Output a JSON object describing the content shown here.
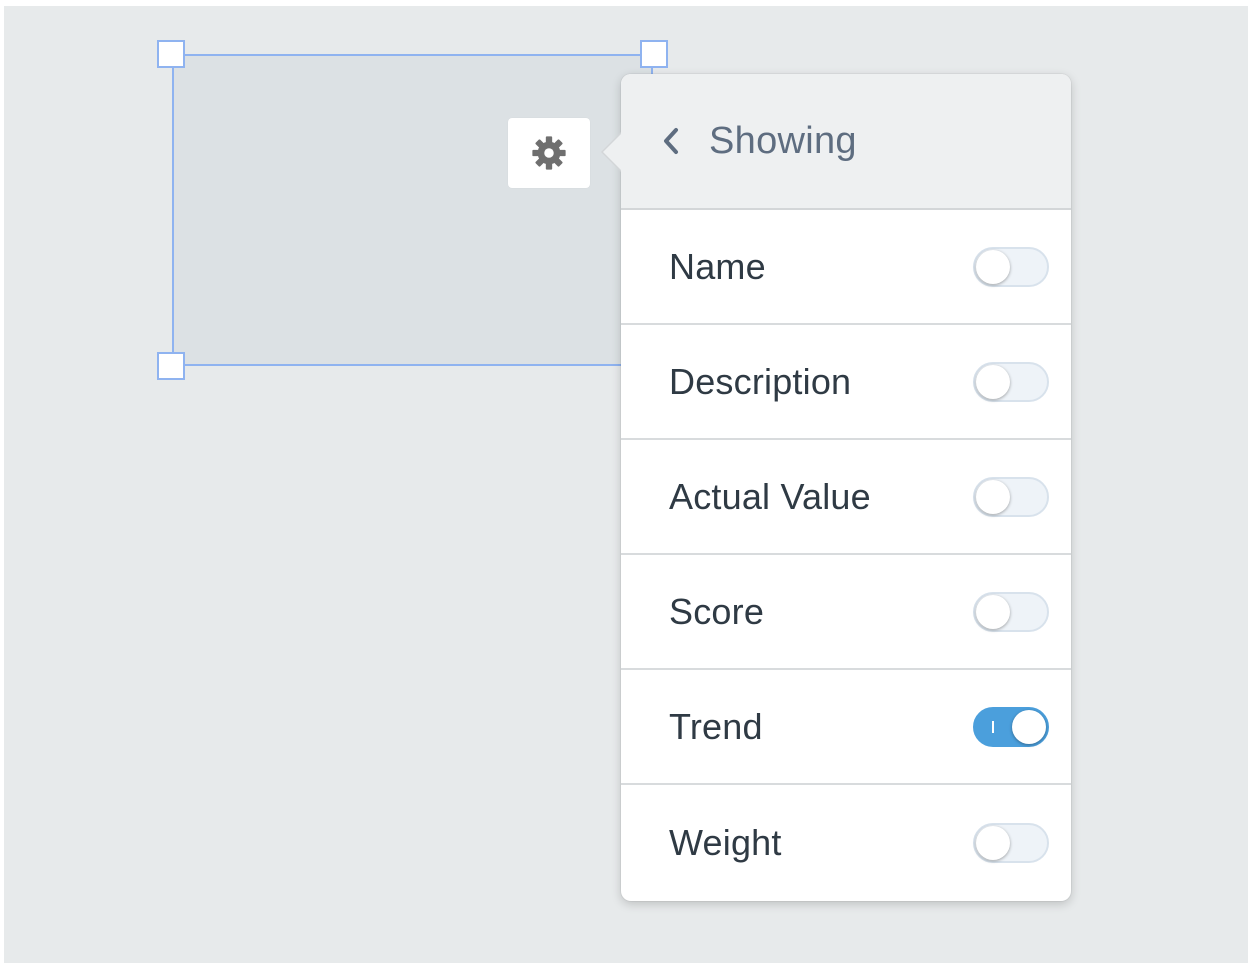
{
  "panel": {
    "title": "Showing",
    "options": [
      {
        "label": "Name",
        "enabled": false
      },
      {
        "label": "Description",
        "enabled": false
      },
      {
        "label": "Actual Value",
        "enabled": false
      },
      {
        "label": "Score",
        "enabled": false
      },
      {
        "label": "Trend",
        "enabled": true
      },
      {
        "label": "Weight",
        "enabled": false
      }
    ]
  },
  "icons": {
    "settings": "gear-icon",
    "back": "chevron-left-icon"
  },
  "colors": {
    "canvas": "#e7eaeb",
    "widget_fill": "#dce1e4",
    "selection": "#8fb3f0",
    "toggle_on": "#4b9fdc",
    "header_text": "#5e6d80",
    "row_text": "#2f3a44"
  }
}
